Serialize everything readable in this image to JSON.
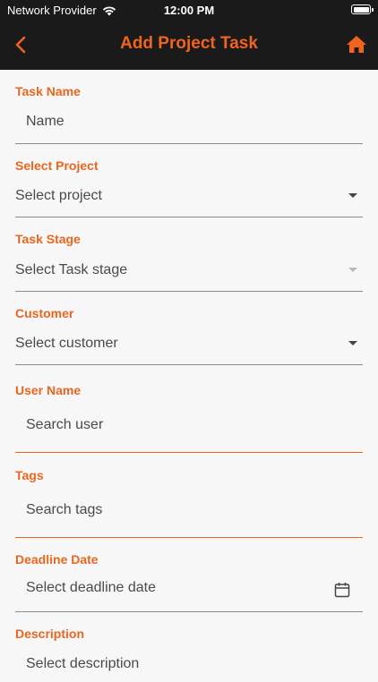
{
  "status_bar": {
    "carrier": "Network Provider",
    "time": "12:00 PM"
  },
  "header": {
    "title": "Add Project Task",
    "back_icon": "chevron-left-icon",
    "home_icon": "home-icon",
    "accent_color": "#f0641e"
  },
  "form": {
    "task_name": {
      "label": "Task Name",
      "placeholder": "Name"
    },
    "project": {
      "label": "Select Project",
      "value": "Select project"
    },
    "task_stage": {
      "label": "Task Stage",
      "value": "Select Task stage"
    },
    "customer": {
      "label": "Customer",
      "value": "Select customer"
    },
    "user_name": {
      "label": "User Name",
      "placeholder": "Search user"
    },
    "tags": {
      "label": "Tags",
      "placeholder": "Search tags"
    },
    "deadline": {
      "label": "Deadline Date",
      "placeholder": "Select deadline date",
      "icon": "calendar-icon"
    },
    "description": {
      "label": "Description",
      "placeholder": "Select description"
    }
  }
}
